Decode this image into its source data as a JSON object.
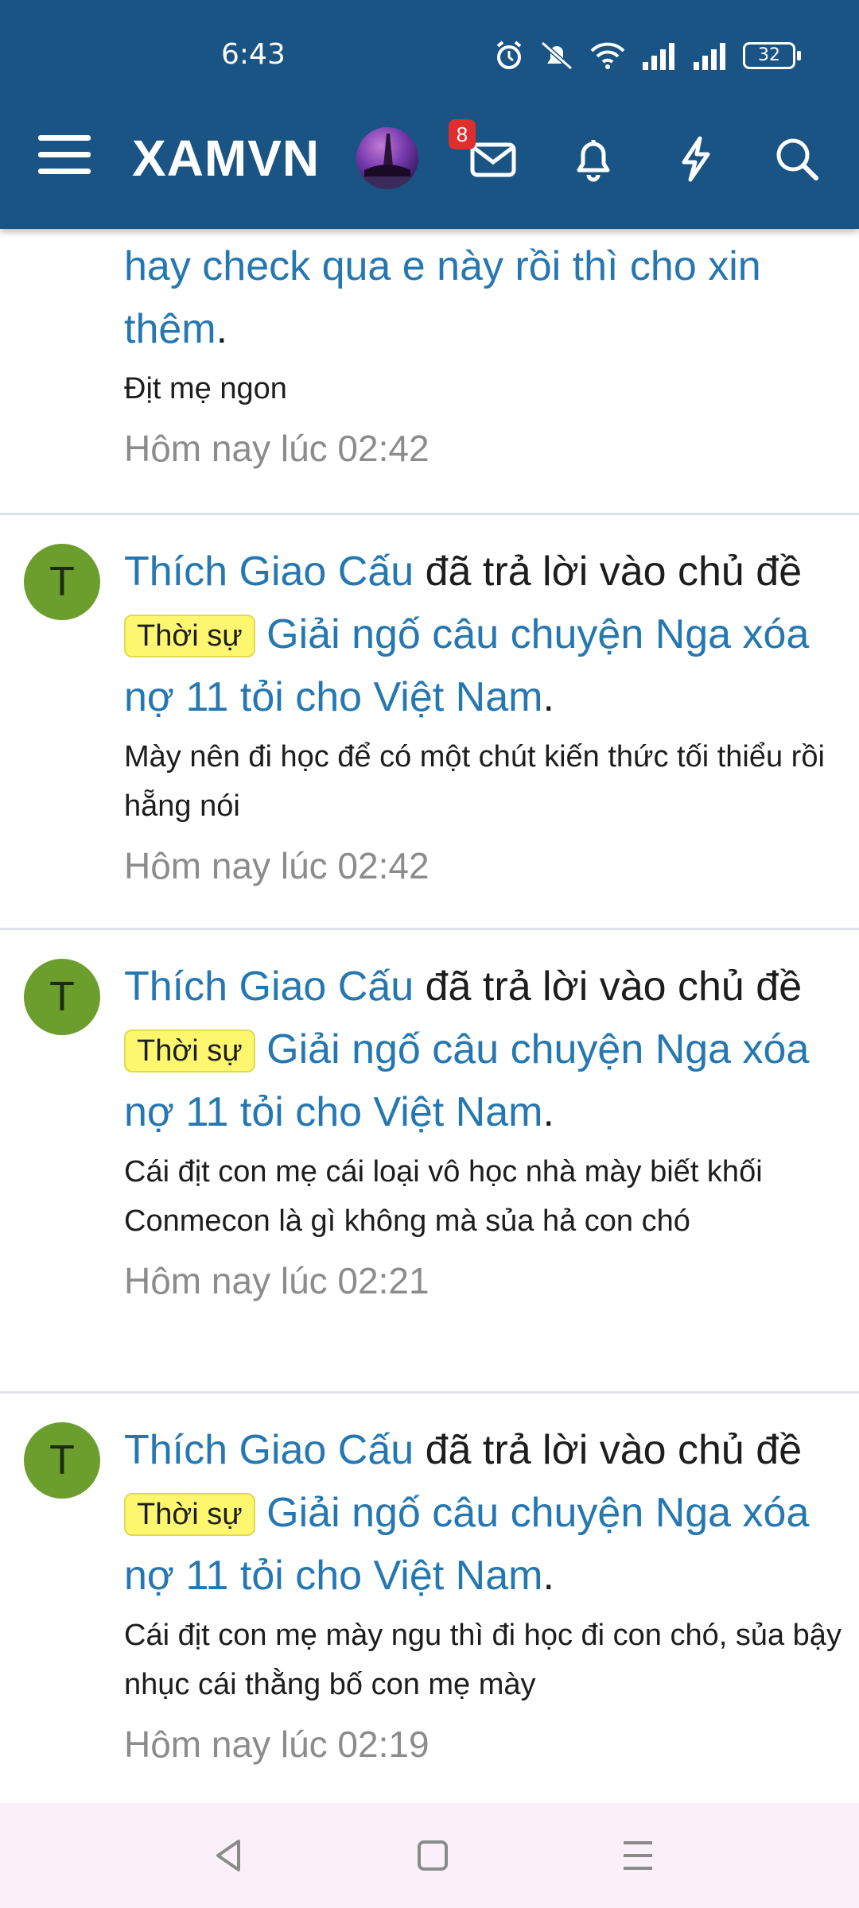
{
  "status_bar": {
    "time": "6:43",
    "battery": "32"
  },
  "header": {
    "brand": "XAMVN",
    "message_badge": "8"
  },
  "icons": {
    "menu": "hamburger-menu-icon",
    "messages": "envelope-icon",
    "alerts": "bell-icon",
    "whats_new": "lightning-icon",
    "search": "search-icon"
  },
  "feed": [
    {
      "title_tail": "hay check qua e này rồi thì cho xin thêm",
      "snippet": "Địt mẹ ngon",
      "time": "Hôm nay lúc 02:42"
    },
    {
      "avatar": "T",
      "user": "Thích Giao Cấu",
      "action": "đã trả lời vào chủ đề",
      "tag": "Thời sự",
      "thread": "Giải ngố câu chuyện Nga xóa nợ 11 tỏi cho Việt Nam",
      "snippet": "Mày nên đi học để có một chút kiến thức tối thiểu rồi hẵng nói",
      "time": "Hôm nay lúc 02:42"
    },
    {
      "avatar": "T",
      "user": "Thích Giao Cấu",
      "action": "đã trả lời vào chủ đề",
      "tag": "Thời sự",
      "thread": "Giải ngố câu chuyện Nga xóa nợ 11 tỏi cho Việt Nam",
      "snippet": "Cái địt con mẹ cái loại vô học nhà mày biết khối Conmecon là gì không mà sủa hả con chó",
      "time": "Hôm nay lúc 02:21"
    },
    {
      "avatar": "T",
      "user": "Thích Giao Cấu",
      "action": "đã trả lời vào chủ đề",
      "tag": "Thời sự",
      "thread": "Giải ngố câu chuyện Nga xóa nợ 11 tỏi cho Việt Nam",
      "snippet": "Cái địt con mẹ mày ngu thì đi học đi con chó, sủa bậy nhục cái thằng bố con mẹ mày",
      "time": "Hôm nay lúc 02:19"
    }
  ],
  "punct": "."
}
